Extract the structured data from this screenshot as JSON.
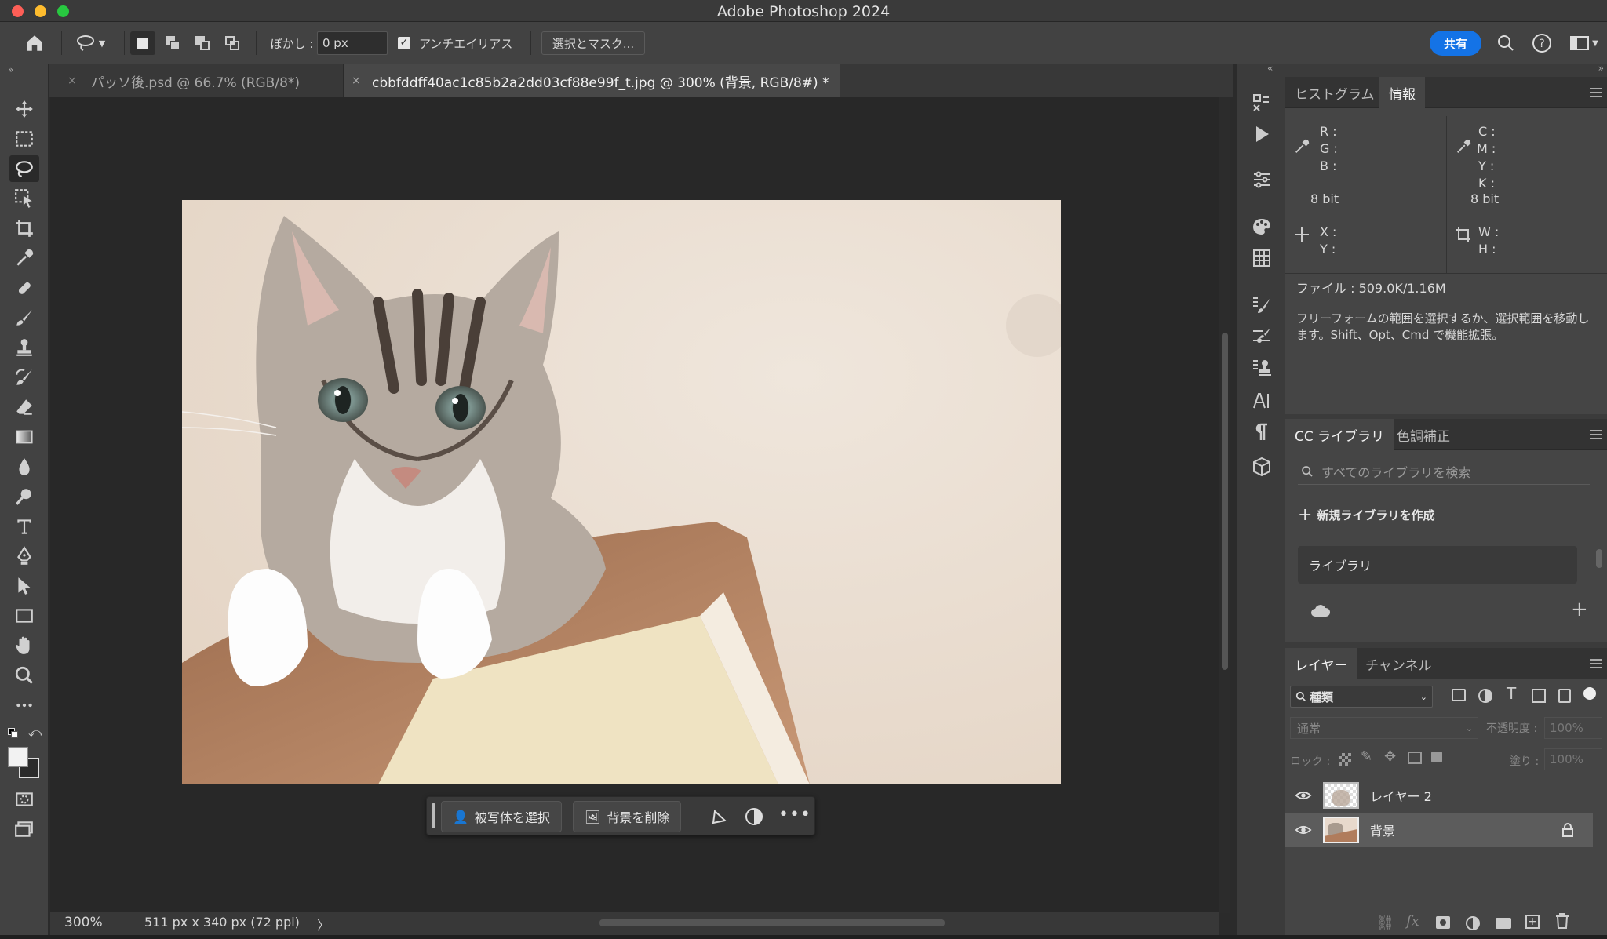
{
  "app": {
    "title": "Adobe Photoshop 2024"
  },
  "colors": {
    "accent": "#1473e6",
    "close": "#fe5f57",
    "minimize": "#febc2e",
    "zoom": "#28c840"
  },
  "options_bar": {
    "feather_label": "ぼかし :",
    "feather_value": "0 px",
    "antialias_label": "アンチエイリアス",
    "antialias_checked": true,
    "select_mask_label": "選択とマスク...",
    "share_label": "共有"
  },
  "tabs": [
    {
      "label": "パッソ後.psd @ 66.7% (RGB/8*)",
      "active": false
    },
    {
      "label": "cbbfddff40ac1c85b2a2dd03cf88e99f_t.jpg @ 300% (背景, RGB/8#) *",
      "active": true
    }
  ],
  "tools": [
    "move-icon",
    "marquee-icon",
    "lasso-icon",
    "object-select-icon",
    "crop-icon",
    "eyedropper-icon",
    "healing-icon",
    "brush-icon",
    "stamp-icon",
    "history-brush-icon",
    "eraser-icon",
    "gradient-icon",
    "blur-icon",
    "dodge-icon",
    "type-icon",
    "pen-icon",
    "path-select-icon",
    "rectangle-icon",
    "hand-icon",
    "zoom-icon",
    "more-icon"
  ],
  "context_bar": {
    "select_subject": "被写体を選択",
    "remove_background": "背景を削除"
  },
  "status": {
    "zoom": "300%",
    "doc_size": "511 px x 340 px (72 ppi)"
  },
  "info_panel": {
    "tabs": [
      "ヒストグラム",
      "情報"
    ],
    "active_tab": "情報",
    "rgb_labels": [
      "R :",
      "G :",
      "B :"
    ],
    "cmyk_labels": [
      "C :",
      "M :",
      "Y :",
      "K :"
    ],
    "bit_left": "8 bit",
    "bit_right": "8 bit",
    "xy_labels": [
      "X :",
      "Y :"
    ],
    "wh_labels": [
      "W :",
      "H :"
    ],
    "file_info": "ファイル : 509.0K/1.16M",
    "hint": "フリーフォームの範囲を選択するか、選択範囲を移動します。Shift、Opt、Cmd で機能拡張。"
  },
  "cc_panel": {
    "tabs": [
      "CC ライブラリ",
      "色調補正"
    ],
    "active_tab": "CC ライブラリ",
    "search_placeholder": "すべてのライブラリを検索",
    "new_library": "新規ライブラリを作成",
    "library_item": "ライブラリ"
  },
  "layers_panel": {
    "tabs": [
      "レイヤー",
      "チャンネル"
    ],
    "active_tab": "レイヤー",
    "filter_kind": "種類",
    "blend_mode": "通常",
    "opacity_label": "不透明度 :",
    "opacity_value": "100%",
    "lock_label": "ロック :",
    "fill_label": "塗り :",
    "fill_value": "100%",
    "layers": [
      {
        "name": "レイヤー 2",
        "visible": true,
        "selected": false,
        "locked": false
      },
      {
        "name": "背景",
        "visible": true,
        "selected": true,
        "locked": true
      }
    ]
  }
}
